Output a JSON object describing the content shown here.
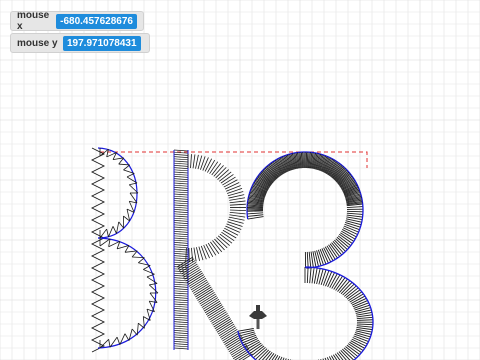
{
  "monitors": {
    "mouse_x": {
      "label": "mouse x",
      "value": "-680.457628676"
    },
    "mouse_y": {
      "label": "mouse y",
      "value": "197.971078431"
    }
  },
  "colors": {
    "grid": "#e3e3e3",
    "grid_major": "#d8d8d8",
    "stitch": "#1a1a1a",
    "outline": "#1a1adc",
    "guide": "#e03030",
    "monitor_value_bg": "#1e8cdc"
  },
  "embroidered_text": "BRS",
  "icons": [
    "sewing-needle-icon"
  ]
}
